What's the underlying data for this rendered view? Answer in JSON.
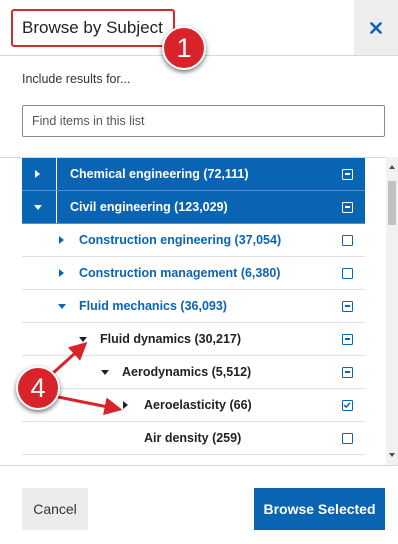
{
  "header": {
    "title": "Browse by Subject",
    "close_icon": "close-icon",
    "close_glyph": "×"
  },
  "annotations": {
    "step_1": "1",
    "step_4": "4",
    "color": "#d8232a"
  },
  "include_label": "Include results for...",
  "search": {
    "placeholder": "Find items in this list",
    "value": ""
  },
  "tree": {
    "rows": [
      {
        "label": "Chemical engineering (72,111)",
        "level": 0,
        "toggle": "collapsed",
        "selected": true,
        "checkbox": "partial"
      },
      {
        "label": "Civil engineering (123,029)",
        "level": 0,
        "toggle": "expanded",
        "selected": true,
        "checkbox": "partial"
      },
      {
        "label": "Construction engineering (37,054)",
        "level": 1,
        "toggle": "collapsed",
        "selected": false,
        "checkbox": "unchecked"
      },
      {
        "label": "Construction management (6,380)",
        "level": 1,
        "toggle": "collapsed",
        "selected": false,
        "checkbox": "unchecked"
      },
      {
        "label": "Fluid mechanics (36,093)",
        "level": 1,
        "toggle": "expanded",
        "selected": false,
        "checkbox": "partial"
      },
      {
        "label": "Fluid dynamics (30,217)",
        "level": 2,
        "toggle": "expanded",
        "selected": false,
        "checkbox": "partial"
      },
      {
        "label": "Aerodynamics (5,512)",
        "level": 3,
        "toggle": "expanded",
        "selected": false,
        "checkbox": "partial"
      },
      {
        "label": "Aeroelasticity (66)",
        "level": 4,
        "toggle": "collapsed",
        "selected": false,
        "checkbox": "checked"
      },
      {
        "label": "Air density (259)",
        "level": 4,
        "toggle": "none",
        "selected": false,
        "checkbox": "unchecked"
      }
    ]
  },
  "footer": {
    "cancel_label": "Cancel",
    "browse_label": "Browse Selected"
  },
  "colors": {
    "accent": "#0a64b4",
    "annotation_red": "#d8232a"
  }
}
